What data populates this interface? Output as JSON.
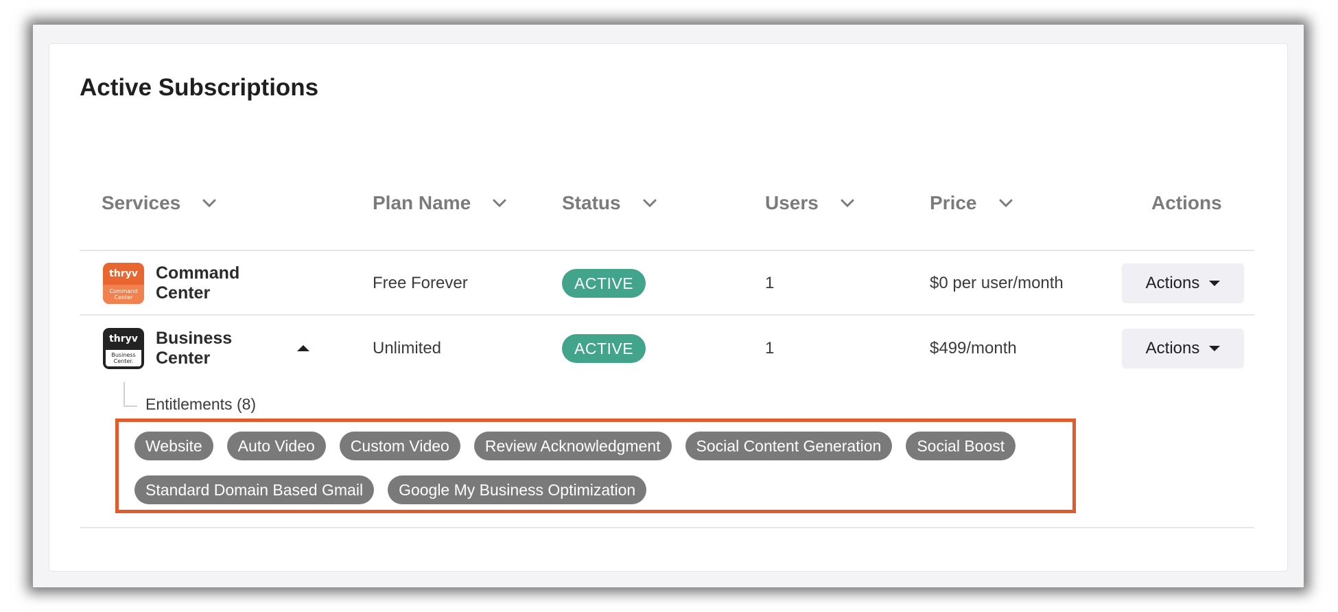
{
  "page": {
    "title": "Active Subscriptions"
  },
  "columns": {
    "services": "Services",
    "plan_name": "Plan Name",
    "status": "Status",
    "users": "Users",
    "price": "Price",
    "actions": "Actions"
  },
  "rows": [
    {
      "logo_brand": "thryv",
      "logo_sub": "Command Center",
      "service_line1": "Command",
      "service_line2": "Center",
      "plan": "Free Forever",
      "status": "ACTIVE",
      "users": "1",
      "price": "$0 per user/month",
      "actions_label": "Actions"
    },
    {
      "logo_brand": "thryv",
      "logo_sub": "Business Center.",
      "service_line1": "Business",
      "service_line2": "Center",
      "plan": "Unlimited",
      "status": "ACTIVE",
      "users": "1",
      "price": "$499/month",
      "actions_label": "Actions"
    }
  ],
  "entitlements": {
    "label": "Entitlements (8)",
    "items": [
      "Website",
      "Auto Video",
      "Custom Video",
      "Review Acknowledgment",
      "Social Content Generation",
      "Social Boost",
      "Standard Domain Based Gmail",
      "Google My Business Optimization"
    ]
  },
  "colors": {
    "status_active": "#41a48b",
    "highlight_border": "#e05c2c",
    "chip_bg": "#7a7a7a"
  },
  "icons": {
    "sort": "chevron-down-icon",
    "collapse": "caret-up-icon",
    "actions_dropdown": "caret-down-icon"
  }
}
